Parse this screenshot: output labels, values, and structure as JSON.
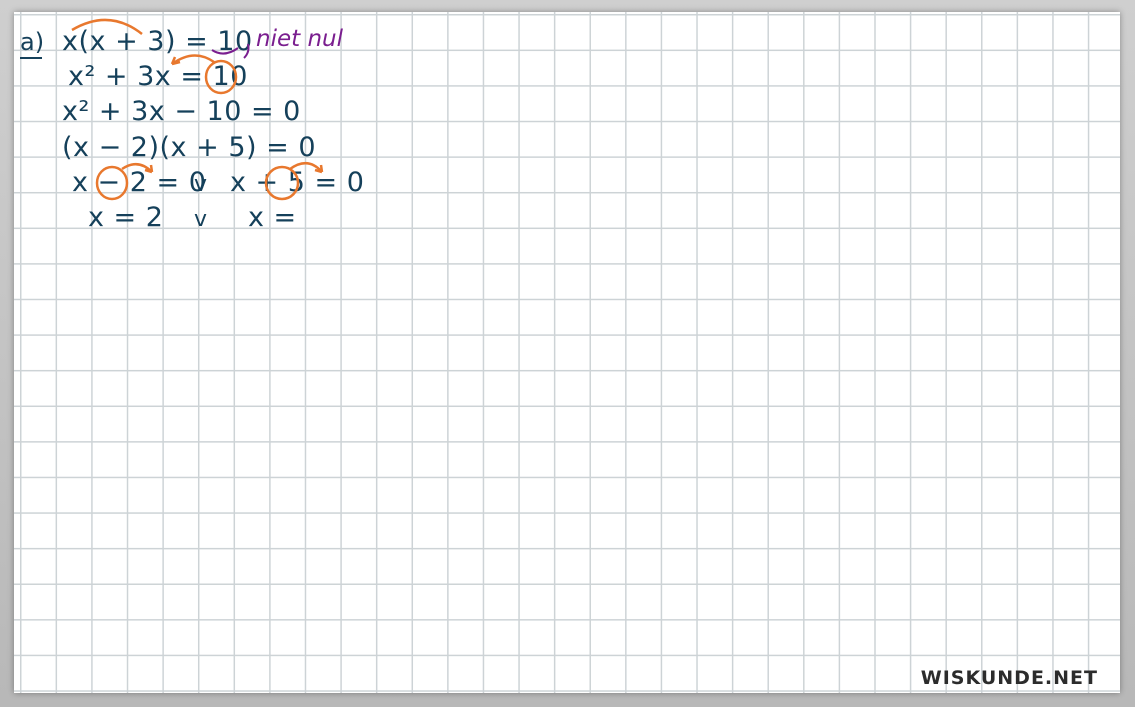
{
  "part_label": "a)",
  "note": "niet nul",
  "lines": [
    "x(x + 3) = 10",
    "x² + 3x = 10",
    "x² + 3x − 10 = 0",
    "(x − 2)(x + 5) = 0",
    "x − 2 = 0",
    "v",
    "x + 5 = 0",
    "x = 2",
    "v",
    "x ="
  ],
  "watermark": "WISKUNDE.NET",
  "colors": {
    "ink": "#15405a",
    "highlight": "#e8782e",
    "note": "#7a1e8f"
  }
}
